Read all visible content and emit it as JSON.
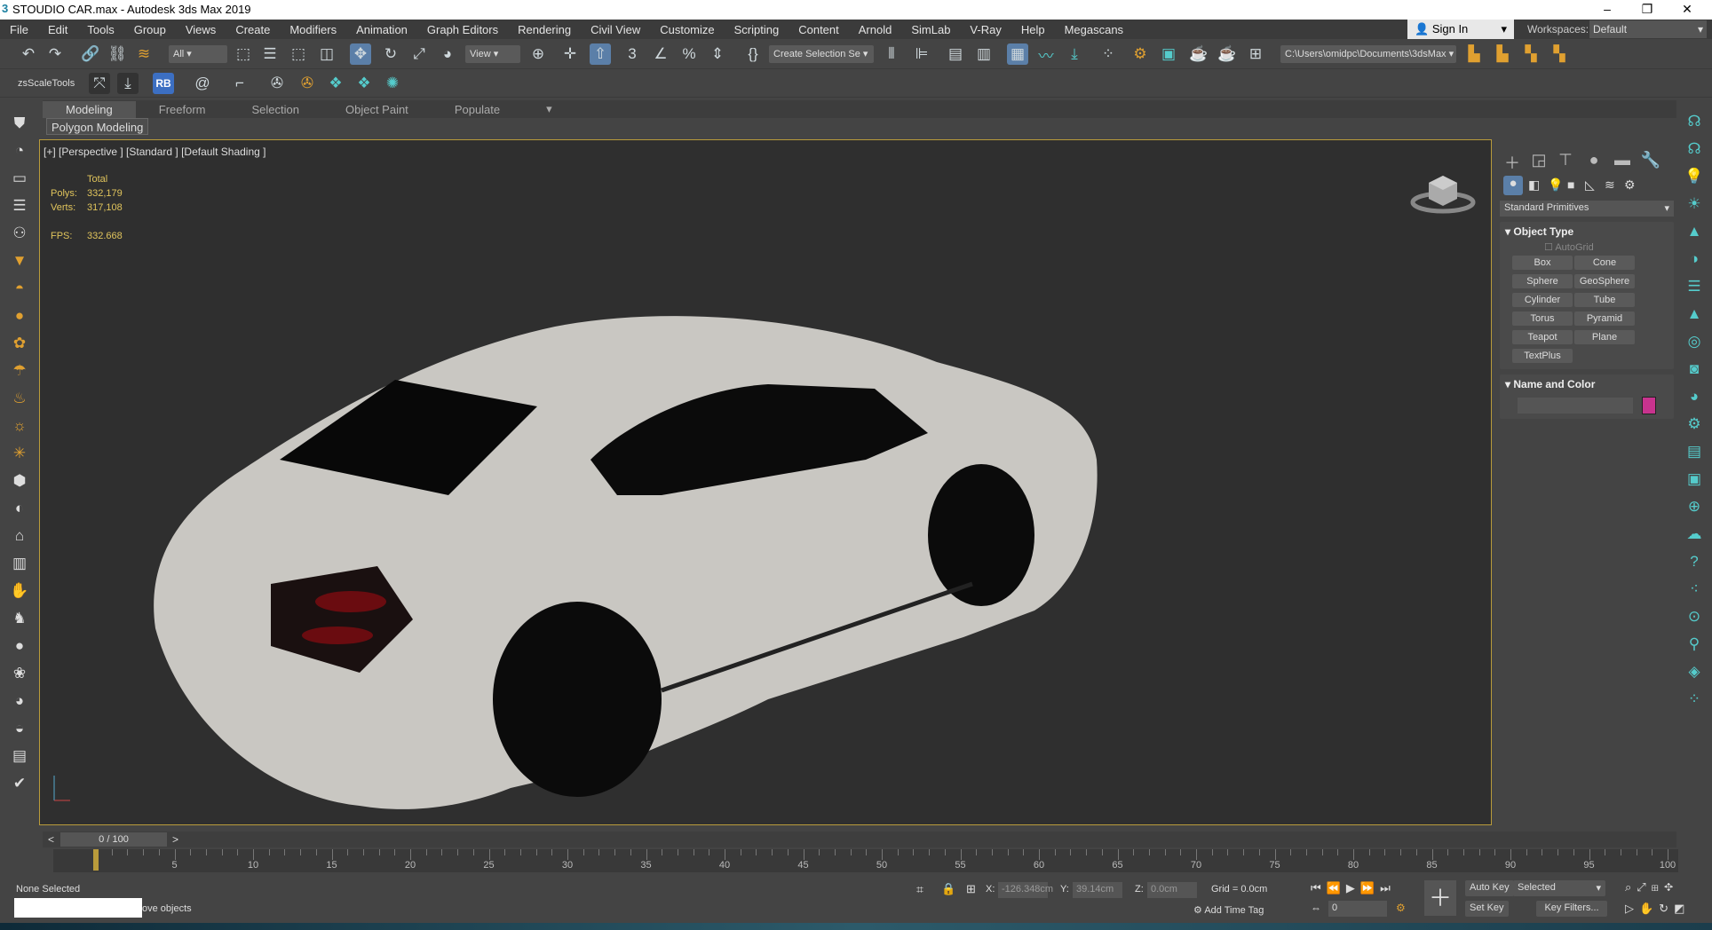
{
  "window": {
    "title": "STOUDIO  CAR.max - Autodesk 3ds Max 2019",
    "minimize": "–",
    "maximize": "❐",
    "close": "✕"
  },
  "menu": [
    "File",
    "Edit",
    "Tools",
    "Group",
    "Views",
    "Create",
    "Modifiers",
    "Animation",
    "Graph Editors",
    "Rendering",
    "Civil View",
    "Customize",
    "Scripting",
    "Content",
    "Arnold",
    "SimLab",
    "V-Ray",
    "Help",
    "Megascans"
  ],
  "account": {
    "sign_in": "Sign In",
    "workspaces_label": "Workspaces:",
    "workspace": "Default"
  },
  "toolbar": {
    "selection_filter": "All",
    "reference_coord": "View",
    "named_selection": "Create Selection Se",
    "project_path": "C:\\Users\\omidpc\\Documents\\3dsMax",
    "zsscale": "zsScaleTools",
    "rb": "RB"
  },
  "ribbon": {
    "tabs": [
      "Modeling",
      "Freeform",
      "Selection",
      "Object Paint",
      "Populate"
    ],
    "active": "Modeling",
    "panel": "Polygon Modeling"
  },
  "viewport": {
    "label": "[+] [Perspective ] [Standard ] [Default Shading ]",
    "stats": {
      "header": "Total",
      "polys_label": "Polys:",
      "polys": "332,179",
      "verts_label": "Verts:",
      "verts": "317,108",
      "fps_label": "FPS:",
      "fps": "332.668"
    }
  },
  "command_panel": {
    "category": "Standard Primitives",
    "object_type": "Object Type",
    "autogrid": "AutoGrid",
    "buttons": [
      "Box",
      "Cone",
      "Sphere",
      "GeoSphere",
      "Cylinder",
      "Tube",
      "Torus",
      "Pyramid",
      "Teapot",
      "Plane",
      "TextPlus"
    ],
    "name_and_color": "Name and Color",
    "object_color": "#c8338e"
  },
  "timeline": {
    "frame": "0 / 100",
    "prev": "<",
    "next": ">",
    "ticks": [
      "0",
      "5",
      "10",
      "15",
      "20",
      "25",
      "30",
      "35",
      "40",
      "45",
      "50",
      "55",
      "60",
      "65",
      "70",
      "75",
      "80",
      "85",
      "90",
      "95",
      "100"
    ]
  },
  "status": {
    "selection": "None Selected",
    "prompt": "ove objects",
    "x_label": "X:",
    "x": "-126.348cm",
    "y_label": "Y:",
    "y": "39.14cm",
    "z_label": "Z:",
    "z": "0.0cm",
    "grid": "Grid = 0.0cm",
    "add_time_tag": "Add Time Tag",
    "auto_key": "Auto Key",
    "set_key": "Set Key",
    "key_mode": "Selected",
    "key_filters": "Key Filters...",
    "current_frame": "0"
  }
}
